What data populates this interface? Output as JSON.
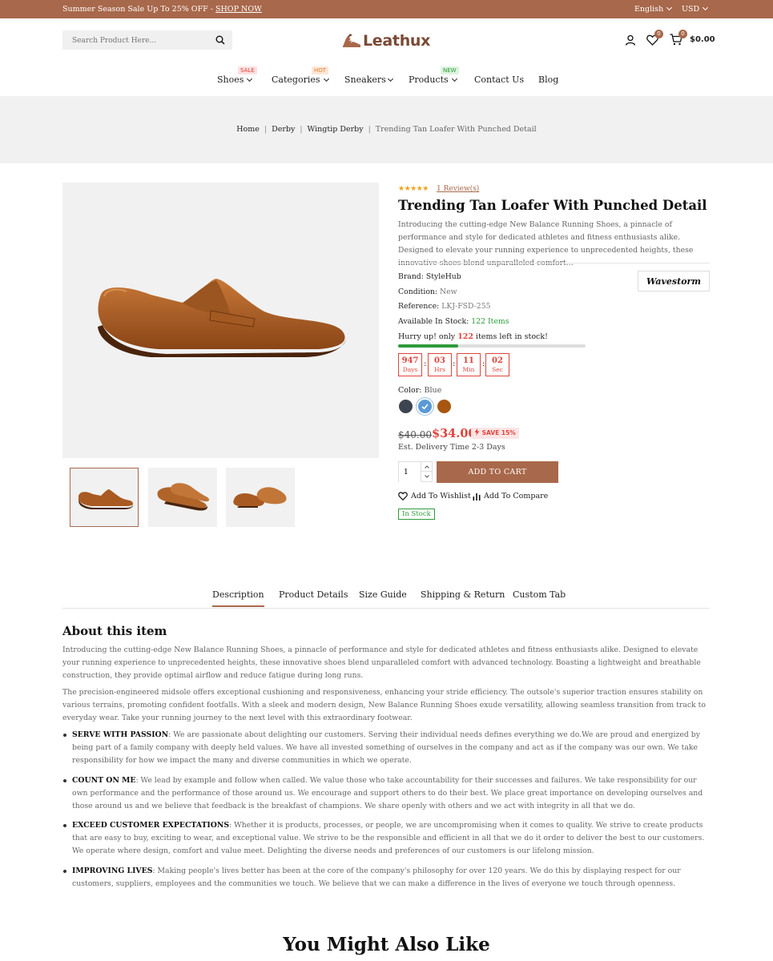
{
  "topbar": {
    "promo_text": "Summer Season Sale Up To 25% OFF - ",
    "promo_link": "SHOP NOW",
    "language": "English",
    "currency": "USD"
  },
  "header": {
    "search_placeholder": "Search Product Here...",
    "logo_text": "Leathux",
    "wishlist_count": "0",
    "cart_count": "0",
    "cart_total": "$0.00"
  },
  "nav": {
    "items": [
      {
        "label": "Shoes",
        "tag": "SALE"
      },
      {
        "label": "Categories",
        "tag": "HOT"
      },
      {
        "label": "Sneakers",
        "tag": ""
      },
      {
        "label": "Products",
        "tag": "NEW"
      },
      {
        "label": "Contact Us",
        "tag": ""
      },
      {
        "label": "Blog",
        "tag": ""
      }
    ]
  },
  "breadcrumb": [
    "Home",
    "Derby",
    "Wingtip Derby",
    "Trending Tan Loafer With Punched Detail"
  ],
  "product": {
    "rating": 5,
    "reviews_label": "1 Review(s)",
    "title": "Trending Tan Loafer With Punched Detail",
    "short_desc": "Introducing the cutting-edge New Balance Running Shoes, a pinnacle of performance and style for dedicated athletes and fitness enthusiasts alike. Designed to elevate your running experience to unprecedented heights, these innovative shoes blend unparalleled comfort...",
    "brand_label": "Brand:",
    "brand": "StyleHub",
    "brand_logo_text": "Wavestorm",
    "condition_label": "Condition:",
    "condition": "New",
    "reference_label": "Reference:",
    "reference": "LKJ-FSD-255",
    "stock_label": "Available In Stock:",
    "stock": "122 Items",
    "hurry_prefix": "Hurry up! only ",
    "hurry_count": "122",
    "hurry_suffix": " items left in stock!",
    "stock_fraction": 0.32,
    "countdown": [
      {
        "value": "947",
        "unit": "Days"
      },
      {
        "value": "03",
        "unit": "Hrs"
      },
      {
        "value": "11",
        "unit": "Min"
      },
      {
        "value": "02",
        "unit": "Sec"
      }
    ],
    "color_label": "Color:",
    "color_value": "Blue",
    "swatches": [
      {
        "name": "dark-gray",
        "hex": "#3d4451"
      },
      {
        "name": "blue",
        "hex": "#5b9ad6"
      },
      {
        "name": "brown",
        "hex": "#a8560f"
      }
    ],
    "old_price": "$40.00",
    "new_price": "$34.00",
    "save_label": "SAVE 15%",
    "delivery": "Est. Delivery Time 2-3 Days",
    "quantity": "1",
    "add_to_cart": "ADD TO CART",
    "wishlist_label": "Add To Wishlist",
    "compare_label": "Add To Compare",
    "availability": "In Stock"
  },
  "tabs": [
    "Description",
    "Product Details",
    "Size Guide",
    "Shipping & Return",
    "Custom Tab"
  ],
  "description": {
    "heading": "About this item",
    "paragraphs": [
      "Introducing the cutting-edge New Balance Running Shoes, a pinnacle of performance and style for dedicated athletes and fitness enthusiasts alike. Designed to elevate your running experience to unprecedented heights, these innovative shoes blend unparalleled comfort with advanced technology. Boasting a lightweight and breathable construction, they provide optimal airflow and reduce fatigue during long runs.",
      "The precision-engineered midsole offers exceptional cushioning and responsiveness, enhancing your stride efficiency. The outsole's superior traction ensures stability on various terrains, promoting confident footfalls. With a sleek and modern design, New Balance Running Shoes exude versatility, allowing seamless transition from track to everyday wear. Take your running journey to the next level with this extraordinary footwear."
    ],
    "bullets": [
      {
        "title": "SERVE WITH PASSION",
        "text": ": We are passionate about delighting our customers. Serving their individual needs defines everything we do.We are proud and energized by being part of a family company with deeply held values. We have all invested something of ourselves in the company and act as if the company was our own. We take responsibility for how we impact the many and diverse communities in which we operate."
      },
      {
        "title": "COUNT ON ME",
        "text": ": We lead by example and follow when called. We value those who take accountability for their successes and failures. We take responsibility for our own performance and the performance of those around us. We encourage and support others to do their best. We place great importance on developing ourselves and those around us and we believe that feedback is the breakfast of champions. We share openly with others and we act with integrity in all that we do."
      },
      {
        "title": "EXCEED CUSTOMER EXPECTATIONS",
        "text": ": Whether it is products, processes, or people, we are uncompromising when it comes to quality. We strive to create products that are easy to buy, exciting to wear, and exceptional value. We strive to be the responsible and efficient in all that we do it order to deliver the best to our customers. We operate where design, comfort and value meet. Delighting the diverse needs and preferences of our customers is our lifelong mission."
      },
      {
        "title": "IMPROVING LIVES",
        "text": ": Making people's lives better has been at the core of the company's philosophy for over 120 years. We do this by displaying respect for our customers, suppliers, employees and the communities we touch. We believe that we can make a difference in the lives of everyone we touch through openness."
      }
    ]
  },
  "related_heading": "You Might Also Like",
  "colors": {
    "accent": "#a8684b",
    "sale_red": "#e0443c",
    "stock_green": "#2e9b3a",
    "star": "#f0a21a"
  }
}
